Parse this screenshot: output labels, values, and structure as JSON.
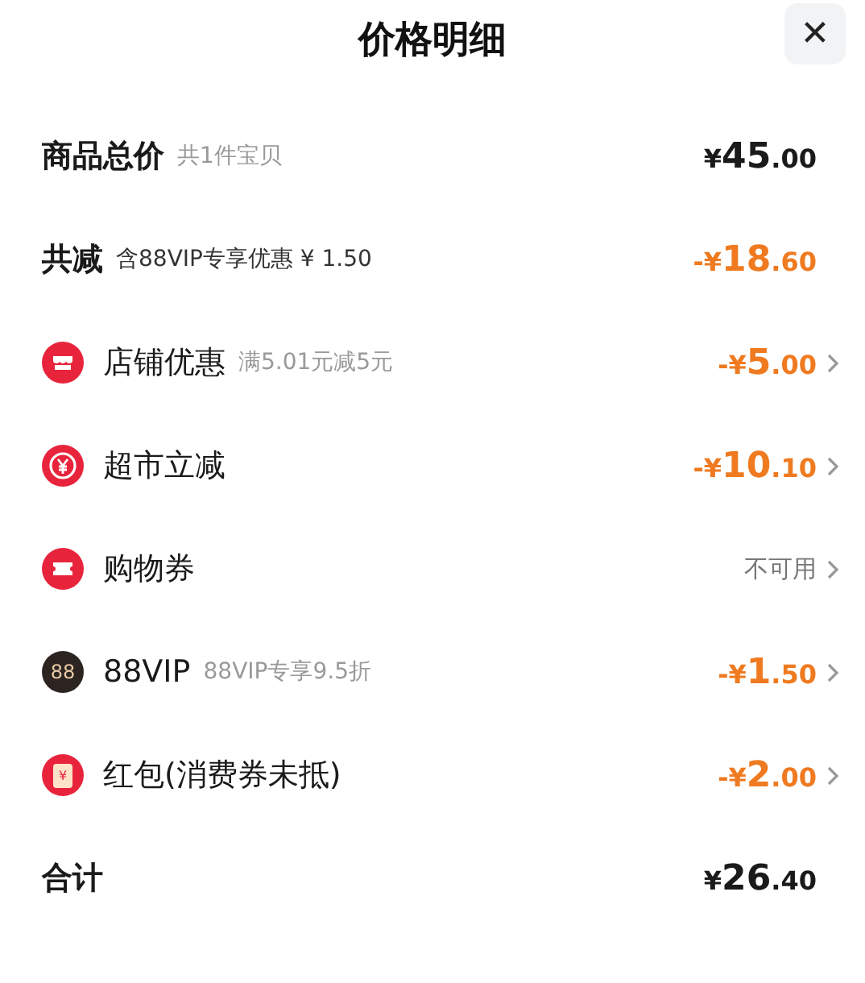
{
  "header": {
    "title": "价格明细",
    "close": "✕"
  },
  "rows": [
    {
      "kind": "summary",
      "label": "商品总价",
      "note": {
        "text": "共1件宝贝",
        "muted": true
      },
      "amount": {
        "prefix": "¥",
        "main": "45",
        "cents": ".00",
        "color": "#1a1a1a"
      },
      "chevron": false
    },
    {
      "kind": "summary",
      "label": "共减",
      "note": {
        "text": "含88VIP专享优惠 ¥ 1.50",
        "muted": false
      },
      "amount": {
        "prefix": "-¥",
        "main": "18",
        "cents": ".60",
        "color": "#ef7a20"
      },
      "chevron": false
    },
    {
      "kind": "store",
      "label": "店铺优惠",
      "note": {
        "text": "满5.01元减5元",
        "muted": true
      },
      "amount": {
        "prefix": "-¥",
        "main": "5",
        "cents": ".00",
        "color": "#ef7a20"
      },
      "chevron": true
    },
    {
      "kind": "market",
      "label": "超市立减",
      "amount": {
        "prefix": "-¥",
        "main": "10",
        "cents": ".10",
        "color": "#ef7a20"
      },
      "chevron": true
    },
    {
      "kind": "coupon",
      "label": "购物券",
      "status": "不可用",
      "chevron": true
    },
    {
      "kind": "vip",
      "label": "88VIP",
      "badge": "88",
      "note": {
        "text": "88VIP专享9.5折",
        "muted": true
      },
      "amount": {
        "prefix": "-¥",
        "main": "1",
        "cents": ".50",
        "color": "#ef7a20"
      },
      "chevron": true
    },
    {
      "kind": "redpacket",
      "label": "红包(消费券未抵)",
      "badge": "¥",
      "amount": {
        "prefix": "-¥",
        "main": "2",
        "cents": ".00",
        "color": "#ef7a20"
      },
      "chevron": true
    },
    {
      "kind": "summary",
      "label": "合计",
      "amount": {
        "prefix": "¥",
        "main": "26",
        "cents": ".40",
        "color": "#1a1a1a"
      },
      "chevron": false
    }
  ]
}
